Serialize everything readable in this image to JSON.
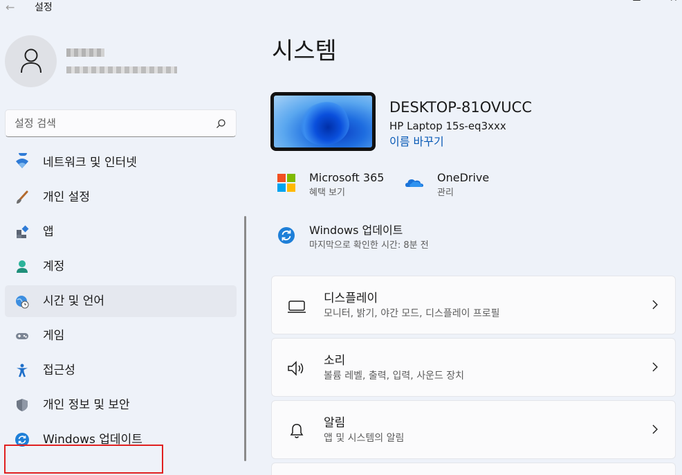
{
  "window": {
    "title": "설정",
    "back_glyph": "←",
    "close_glyph": "✕"
  },
  "account": {
    "name": "",
    "email": ""
  },
  "search": {
    "placeholder": "설정 검색"
  },
  "sidebar": {
    "items": [
      {
        "label": "네트워크 및 인터넷",
        "icon": "wifi-icon"
      },
      {
        "label": "개인 설정",
        "icon": "brush-icon"
      },
      {
        "label": "앱",
        "icon": "apps-icon"
      },
      {
        "label": "계정",
        "icon": "person-icon"
      },
      {
        "label": "시간 및 언어",
        "icon": "globe-clock-icon",
        "active": true
      },
      {
        "label": "게임",
        "icon": "gamepad-icon"
      },
      {
        "label": "접근성",
        "icon": "accessibility-icon"
      },
      {
        "label": "개인 정보 및 보안",
        "icon": "shield-icon"
      },
      {
        "label": "Windows 업데이트",
        "icon": "sync-icon",
        "highlighted": true
      }
    ]
  },
  "main": {
    "page_title": "시스템",
    "device": {
      "name": "DESKTOP-81OVUCC",
      "model": "HP Laptop 15s-eq3xxx",
      "rename_label": "이름 바꾸기"
    },
    "quick_actions": [
      {
        "title": "Microsoft 365",
        "subtitle": "혜택 보기",
        "icon": "microsoft-logo-icon"
      },
      {
        "title": "OneDrive",
        "subtitle": "관리",
        "icon": "onedrive-cloud-icon"
      },
      {
        "title": "Windows 업데이트",
        "subtitle": "마지막으로 확인한 시간: 8분 전",
        "icon": "sync-icon"
      }
    ],
    "cards": [
      {
        "title": "디스플레이",
        "subtitle": "모니터, 밝기, 야간 모드, 디스플레이 프로필",
        "icon": "monitor-icon"
      },
      {
        "title": "소리",
        "subtitle": "볼륨 레벨, 출력, 입력, 사운드 장치",
        "icon": "speaker-icon"
      },
      {
        "title": "알림",
        "subtitle": "앱 및 시스템의 알림",
        "icon": "bell-icon"
      }
    ]
  },
  "colors": {
    "background": "#eef2f9",
    "accent": "#0a5bb6",
    "highlight_border": "#e02020",
    "card_background": "#fbfbfc"
  }
}
